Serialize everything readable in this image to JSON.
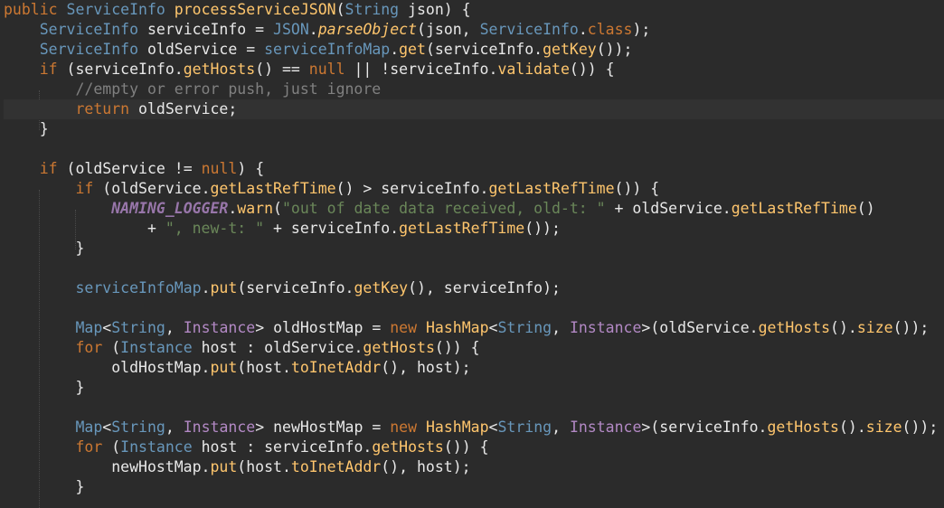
{
  "theme": {
    "background": "#2b2b2b",
    "current_line": "#323232",
    "plain": "#e8e8e8",
    "keyword": "#cc7832",
    "type": "#6897bb",
    "method": "#ffc66d",
    "string": "#6a8759",
    "comment": "#808080",
    "generic_type": "#b389c5",
    "static_field": "#9876aa"
  },
  "editor": {
    "lines": [
      [
        [
          "kw",
          "public"
        ],
        [
          "p",
          " "
        ],
        [
          "ty",
          "ServiceInfo"
        ],
        [
          "p",
          " "
        ],
        [
          "fn",
          "processServiceJSON"
        ],
        [
          "p",
          "("
        ],
        [
          "ty",
          "String"
        ],
        [
          "p",
          " json) {"
        ]
      ],
      [
        [
          "p",
          "    "
        ],
        [
          "ty",
          "ServiceInfo"
        ],
        [
          "p",
          " serviceInfo = "
        ],
        [
          "ty",
          "JSON"
        ],
        [
          "p",
          "."
        ],
        [
          "fi",
          "parseObject"
        ],
        [
          "p",
          "(json, "
        ],
        [
          "ty",
          "ServiceInfo"
        ],
        [
          "p",
          "."
        ],
        [
          "kw",
          "class"
        ],
        [
          "p",
          ");"
        ]
      ],
      [
        [
          "p",
          "    "
        ],
        [
          "ty",
          "ServiceInfo"
        ],
        [
          "p",
          " oldService = "
        ],
        [
          "ty",
          "serviceInfoMap"
        ],
        [
          "p",
          "."
        ],
        [
          "fn",
          "get"
        ],
        [
          "p",
          "(serviceInfo."
        ],
        [
          "fn",
          "getKey"
        ],
        [
          "p",
          "());"
        ]
      ],
      [
        [
          "p",
          "    "
        ],
        [
          "kw",
          "if"
        ],
        [
          "p",
          " (serviceInfo."
        ],
        [
          "fn",
          "getHosts"
        ],
        [
          "p",
          "() == "
        ],
        [
          "kw",
          "null"
        ],
        [
          "p",
          " || !serviceInfo."
        ],
        [
          "fn",
          "validate"
        ],
        [
          "p",
          "()) {"
        ]
      ],
      [
        [
          "p",
          "        "
        ],
        [
          "cm",
          "//empty or error push, just ignore"
        ]
      ],
      [
        [
          "p",
          "        "
        ],
        [
          "kw",
          "return"
        ],
        [
          "p",
          " oldService;"
        ]
      ],
      [
        [
          "p",
          "    }"
        ]
      ],
      [],
      [
        [
          "p",
          "    "
        ],
        [
          "kw",
          "if"
        ],
        [
          "p",
          " (oldService != "
        ],
        [
          "kw",
          "null"
        ],
        [
          "p",
          ") {"
        ]
      ],
      [
        [
          "p",
          "        "
        ],
        [
          "kw",
          "if"
        ],
        [
          "p",
          " (oldService."
        ],
        [
          "fn",
          "getLastRefTime"
        ],
        [
          "p",
          "() > serviceInfo."
        ],
        [
          "fn",
          "getLastRefTime"
        ],
        [
          "p",
          "()) {"
        ]
      ],
      [
        [
          "p",
          "            "
        ],
        [
          "sf",
          "NAMING_LOGGER"
        ],
        [
          "p",
          "."
        ],
        [
          "fn",
          "warn"
        ],
        [
          "p",
          "("
        ],
        [
          "st",
          "\"out of date data received, old-t: \""
        ],
        [
          "p",
          " + oldService."
        ],
        [
          "fn",
          "getLastRefTime"
        ],
        [
          "p",
          "()"
        ]
      ],
      [
        [
          "p",
          "                + "
        ],
        [
          "st",
          "\", new-t: \""
        ],
        [
          "p",
          " + serviceInfo."
        ],
        [
          "fn",
          "getLastRefTime"
        ],
        [
          "p",
          "());"
        ]
      ],
      [
        [
          "p",
          "        }"
        ]
      ],
      [],
      [
        [
          "p",
          "        "
        ],
        [
          "ty",
          "serviceInfoMap"
        ],
        [
          "p",
          "."
        ],
        [
          "fn",
          "put"
        ],
        [
          "p",
          "(serviceInfo."
        ],
        [
          "fn",
          "getKey"
        ],
        [
          "p",
          "(), serviceInfo);"
        ]
      ],
      [],
      [
        [
          "p",
          "        "
        ],
        [
          "ty",
          "Map"
        ],
        [
          "p",
          "<"
        ],
        [
          "ty",
          "String"
        ],
        [
          "p",
          ", "
        ],
        [
          "gt",
          "Instance"
        ],
        [
          "p",
          "> oldHostMap = "
        ],
        [
          "kw",
          "new"
        ],
        [
          "p",
          " "
        ],
        [
          "fn",
          "HashMap"
        ],
        [
          "p",
          "<"
        ],
        [
          "ty",
          "String"
        ],
        [
          "p",
          ", "
        ],
        [
          "gt",
          "Instance"
        ],
        [
          "p",
          ">(oldService."
        ],
        [
          "fn",
          "getHosts"
        ],
        [
          "p",
          "()."
        ],
        [
          "fn",
          "size"
        ],
        [
          "p",
          "());"
        ]
      ],
      [
        [
          "p",
          "        "
        ],
        [
          "kw",
          "for"
        ],
        [
          "p",
          " ("
        ],
        [
          "ty",
          "Instance"
        ],
        [
          "p",
          " host : oldService."
        ],
        [
          "fn",
          "getHosts"
        ],
        [
          "p",
          "()) {"
        ]
      ],
      [
        [
          "p",
          "            oldHostMap."
        ],
        [
          "fn",
          "put"
        ],
        [
          "p",
          "(host."
        ],
        [
          "fn",
          "toInetAddr"
        ],
        [
          "p",
          "(), host);"
        ]
      ],
      [
        [
          "p",
          "        }"
        ]
      ],
      [],
      [
        [
          "p",
          "        "
        ],
        [
          "ty",
          "Map"
        ],
        [
          "p",
          "<"
        ],
        [
          "ty",
          "String"
        ],
        [
          "p",
          ", "
        ],
        [
          "gt",
          "Instance"
        ],
        [
          "p",
          "> newHostMap = "
        ],
        [
          "kw",
          "new"
        ],
        [
          "p",
          " "
        ],
        [
          "fn",
          "HashMap"
        ],
        [
          "p",
          "<"
        ],
        [
          "ty",
          "String"
        ],
        [
          "p",
          ", "
        ],
        [
          "gt",
          "Instance"
        ],
        [
          "p",
          ">(serviceInfo."
        ],
        [
          "fn",
          "getHosts"
        ],
        [
          "p",
          "()."
        ],
        [
          "fn",
          "size"
        ],
        [
          "p",
          "());"
        ]
      ],
      [
        [
          "p",
          "        "
        ],
        [
          "kw",
          "for"
        ],
        [
          "p",
          " ("
        ],
        [
          "ty",
          "Instance"
        ],
        [
          "p",
          " host : serviceInfo."
        ],
        [
          "fn",
          "getHosts"
        ],
        [
          "p",
          "()) {"
        ]
      ],
      [
        [
          "p",
          "            newHostMap."
        ],
        [
          "fn",
          "put"
        ],
        [
          "p",
          "(host."
        ],
        [
          "fn",
          "toInetAddr"
        ],
        [
          "p",
          "(), host);"
        ]
      ],
      [
        [
          "p",
          "        }"
        ]
      ]
    ]
  }
}
